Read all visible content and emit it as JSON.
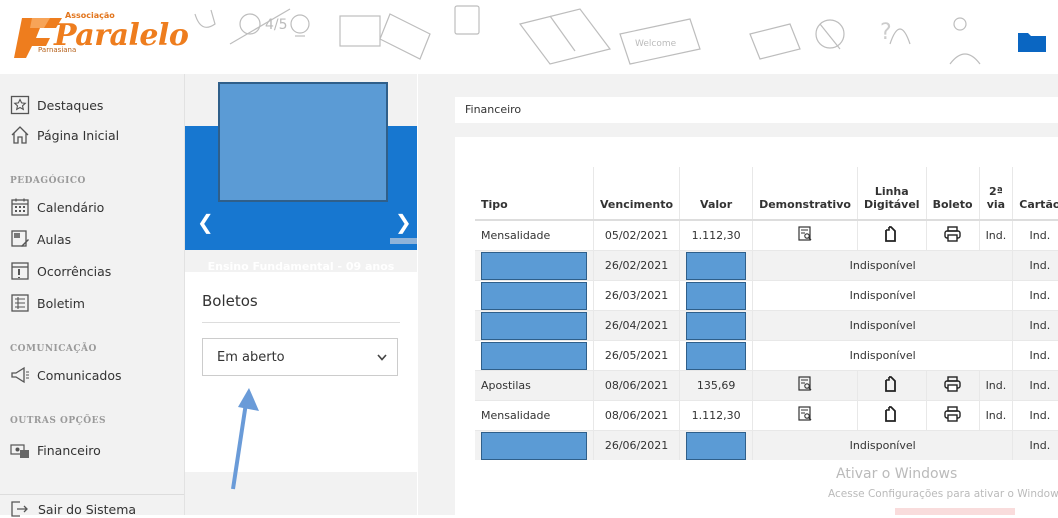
{
  "brand": {
    "assoc": "Associação",
    "name": "Paralelo",
    "city": "Parnasiana"
  },
  "sidebar": {
    "items": [
      {
        "label": "Destaques",
        "icon": "star-icon"
      },
      {
        "label": "Página Inicial",
        "icon": "home-icon"
      }
    ],
    "sections": [
      {
        "title": "PEDAGÓGICO",
        "items": [
          {
            "label": "Calendário",
            "icon": "calendar-icon"
          },
          {
            "label": "Aulas",
            "icon": "lesson-icon"
          },
          {
            "label": "Ocorrências",
            "icon": "incident-icon"
          },
          {
            "label": "Boletim",
            "icon": "report-card-icon"
          }
        ]
      },
      {
        "title": "COMUNICAÇÃO",
        "items": [
          {
            "label": "Comunicados",
            "icon": "megaphone-icon"
          }
        ]
      },
      {
        "title": "OUTRAS OPÇÕES",
        "items": [
          {
            "label": "Financeiro",
            "icon": "money-icon"
          }
        ]
      }
    ],
    "logout": "Sair do Sistema"
  },
  "student": {
    "grade": "Ensino Fundamental - 09 anos"
  },
  "boletos": {
    "title": "Boletos",
    "filter_value": "Em aberto"
  },
  "breadcrumb": "Financeiro",
  "table": {
    "headers": [
      "Tipo",
      "Vencimento",
      "Valor",
      "Demonstrativo",
      "Linha Digitável",
      "Boleto",
      "2ª via",
      "Cartão"
    ],
    "rows": [
      {
        "tipo": "Mensalidade",
        "vencimento": "05/02/2021",
        "valor": "1.112,30",
        "status": "",
        "via2": "Ind.",
        "cartao": "Ind."
      },
      {
        "tipo": "",
        "vencimento": "26/02/2021",
        "valor": "",
        "status": "Indisponível",
        "via2": "",
        "cartao": "Ind."
      },
      {
        "tipo": "",
        "vencimento": "26/03/2021",
        "valor": "",
        "status": "Indisponível",
        "via2": "",
        "cartao": "Ind."
      },
      {
        "tipo": "",
        "vencimento": "26/04/2021",
        "valor": "",
        "status": "Indisponível",
        "via2": "",
        "cartao": "Ind."
      },
      {
        "tipo": "",
        "vencimento": "26/05/2021",
        "valor": "",
        "status": "Indisponível",
        "via2": "",
        "cartao": "Ind."
      },
      {
        "tipo": "Apostilas",
        "vencimento": "08/06/2021",
        "valor": "135,69",
        "status": "",
        "via2": "Ind.",
        "cartao": "Ind."
      },
      {
        "tipo": "Mensalidade",
        "vencimento": "08/06/2021",
        "valor": "1.112,30",
        "status": "",
        "via2": "Ind.",
        "cartao": "Ind."
      },
      {
        "tipo": "",
        "vencimento": "26/06/2021",
        "valor": "",
        "status": "Indisponível",
        "via2": "",
        "cartao": "Ind."
      }
    ]
  },
  "watermark": {
    "line1": "Ativar o Windows",
    "line2": "Acesse Configurações para ativar o Windows"
  },
  "colors": {
    "brand_orange": "#ee7d1e",
    "banner_blue": "#1777d0",
    "redaction_blue": "#5b9bd5"
  }
}
